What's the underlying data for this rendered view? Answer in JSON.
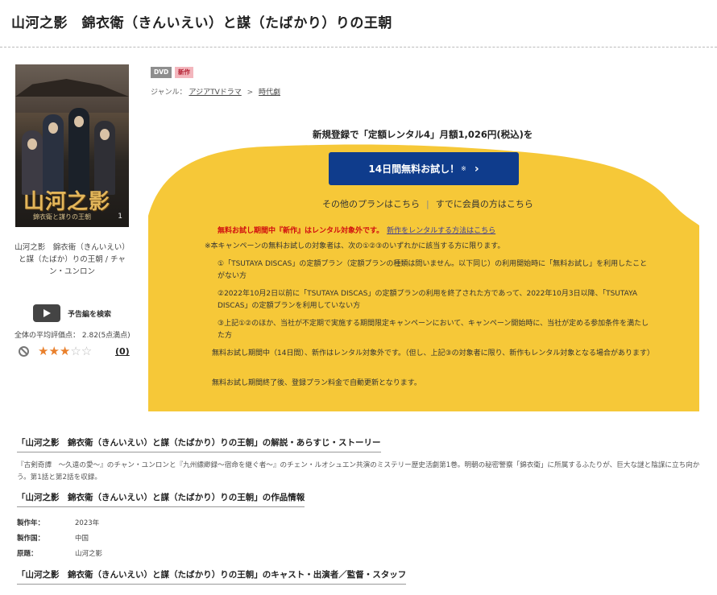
{
  "page": {
    "title": "山河之影　錦衣衛（きんいえい）と謀（たばかり）りの王朝"
  },
  "poster": {
    "logo_text": "山河之影",
    "sub_text": "錦衣衛と謀りの王朝",
    "volume": "1"
  },
  "left": {
    "caption": "山河之影　錦衣衛（きんいえい）と謀（たばか）りの王朝 / チャン・ユンロン",
    "trailer_label": "予告編を検索",
    "rating_label": "全体の平均評価点：",
    "rating_value": "2.82(5点満点)",
    "stars_on": "★★★",
    "stars_off": "☆☆",
    "review_count": "(0)"
  },
  "badges": {
    "dvd": "DVD",
    "new": "新作"
  },
  "genre": {
    "label": "ジャンル：",
    "items": [
      "アジアTVドラマ",
      "時代劇"
    ],
    "sep": ">"
  },
  "promo": {
    "headline": "新規登録で「定額レンタル4」月額1,026円(税込)を",
    "cta_label": "14日間無料お試し！",
    "cta_note": "※",
    "cta_chevron": "›",
    "other_plans": "その他のプランはこちら",
    "members": "すでに会員の方はこちら",
    "link_sep": "|",
    "red_note": "無料お試し期間中『新作』はレンタル対象外です。",
    "red_link": "新作をレンタルする方法はこちら",
    "line_intro": "※本キャンペーンの無料お試しの対象者は、次の①②③のいずれかに該当する方に限ります。",
    "cond1": "①「TSUTAYA DISCAS」の定額プラン（定額プランの種類は問いません。以下同じ）の利用開始時に「無料お試し」を利用したことがない方",
    "cond2": "②2022年10月2日以前に「TSUTAYA DISCAS」の定額プランの利用を終了された方であって、2022年10月3日以降、「TSUTAYA DISCAS」の定額プランを利用していない方",
    "cond3": "③上記①②のほか、当社が不定期で実施する期間限定キャンペーンにおいて、キャンペーン開始時に、当社が定める参加条件を満たした方",
    "note_new": "無料お試し期間中（14日間）、新作はレンタル対象外です。（但し、上記③の対象者に限り、新作もレンタル対象となる場合があります）",
    "note_renew": "無料お試し期間終了後、登録プラン料金で自動更新となります。",
    "yellow": "#f6c838"
  },
  "sections": {
    "synopsis_title": "「山河之影　錦衣衛（きんいえい）と謀（たばかり）りの王朝」の解説・あらすじ・ストーリー",
    "synopsis_text": "『古剣奇譚　～久遠の愛～』のチャン・ユンロンと『九州縹緲録～宿命を継ぐ者～』のチェン・ルオシュエン共演のミステリー歴史活劇第1巻。明朝の秘密警察「錦衣衛」に所属するふたりが、巨大な謎と陰謀に立ち向かう。第1話と第2話を収録。",
    "info_title": "「山河之影　錦衣衛（きんいえい）と謀（たばかり）りの王朝」の作品情報",
    "info": [
      {
        "k": "製作年：",
        "v": "2023年"
      },
      {
        "k": "製作国：",
        "v": "中国"
      },
      {
        "k": "原題：",
        "v": "山河之影"
      }
    ],
    "cast_title": "「山河之影　錦衣衛（きんいえい）と謀（たばかり）りの王朝」のキャスト・出演者／監督・スタッフ"
  }
}
